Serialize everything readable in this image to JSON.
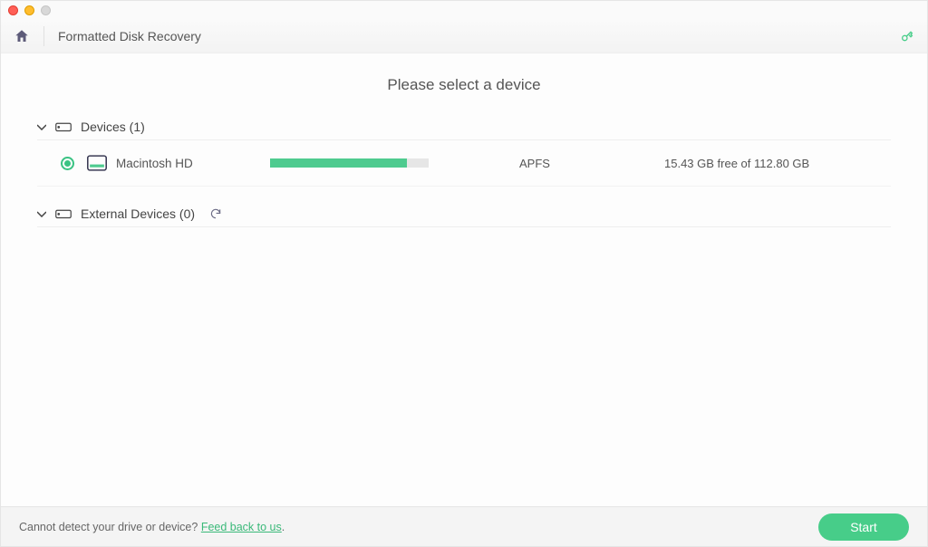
{
  "header": {
    "title": "Formatted Disk Recovery"
  },
  "main": {
    "heading": "Please select a device",
    "groups": {
      "devices": {
        "label": "Devices (1)"
      },
      "external": {
        "label": "External Devices (0)"
      }
    },
    "device": {
      "name": "Macintosh HD",
      "filesystem": "APFS",
      "free_text": "15.43 GB free of 112.80 GB",
      "used_percent": 86
    }
  },
  "footer": {
    "prompt": "Cannot detect your drive or device? ",
    "link_text": "Feed back to us",
    "period": ".",
    "start_label": "Start"
  },
  "colors": {
    "accent": "#47cd89"
  }
}
